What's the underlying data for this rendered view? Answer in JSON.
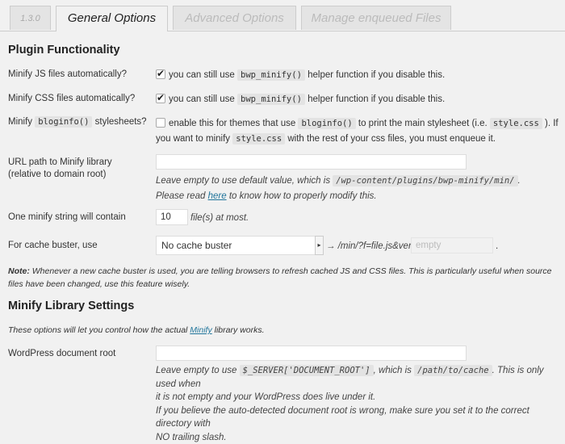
{
  "tabs": {
    "version": "1.3.0",
    "general": "General Options",
    "advanced": "Advanced Options",
    "manage": "Manage enqueued Files"
  },
  "plugin_functionality": {
    "heading": "Plugin Functionality",
    "minify_js": {
      "label": "Minify JS files automatically?",
      "text_before": "you can still use",
      "code": "bwp_minify()",
      "text_after": "helper function if you disable this."
    },
    "minify_css": {
      "label": "Minify CSS files automatically?",
      "text_before": "you can still use",
      "code": "bwp_minify()",
      "text_after": "helper function if you disable this."
    },
    "minify_bloginfo": {
      "label_before": "Minify",
      "label_code": "bloginfo()",
      "label_after": "stylesheets?",
      "text1": "enable this for themes that use",
      "code1": "bloginfo()",
      "text2": "to print the main stylesheet (i.e.",
      "code2": "style.css",
      "text3": "). If",
      "text4": "you want to minify",
      "code3": "style.css",
      "text5": "with the rest of your css files, you must enqueue it."
    },
    "url_path": {
      "label1": "URL path to Minify library",
      "label2": "(relative to domain root)",
      "value": "",
      "desc1_before": "Leave empty to use default value, which is",
      "desc1_code": "/wp-content/plugins/bwp-minify/min/",
      "desc1_after": ".",
      "desc2_before": "Please read",
      "desc2_link": "here",
      "desc2_after": "to know how to properly modify this."
    },
    "minify_string": {
      "label": "One minify string will contain",
      "value": "10",
      "suffix": "file(s) at most."
    },
    "cache_buster": {
      "label": "For cache buster, use",
      "selected": "No cache buster",
      "arrow": "▸",
      "middle": "→ /min/?f=file.js&ver=",
      "placeholder": "empty",
      "end": "."
    },
    "note": {
      "bold": "Note:",
      "text": "Whenever a new cache buster is used, you are telling browsers to refresh cached JS and CSS files. This is particularly useful when source files have been changed, use this feature wisely."
    }
  },
  "minify_library": {
    "heading": "Minify Library Settings",
    "intro_before": "These options will let you control how the actual",
    "intro_link": "Minify",
    "intro_after": "library works.",
    "doc_root": {
      "label": "WordPress document root",
      "value": "",
      "desc1_before": "Leave empty to use",
      "desc1_code1": "$_SERVER['DOCUMENT_ROOT']",
      "desc1_mid": ", which is",
      "desc1_code2": "/path/to/cache",
      "desc1_after": ". This is only used when",
      "desc2": "it is not empty and your WordPress does live under it.",
      "desc3": "If you believe the auto-detected document root is wrong, make sure you set it to the correct directory with",
      "desc4": "NO trailing slash."
    }
  }
}
